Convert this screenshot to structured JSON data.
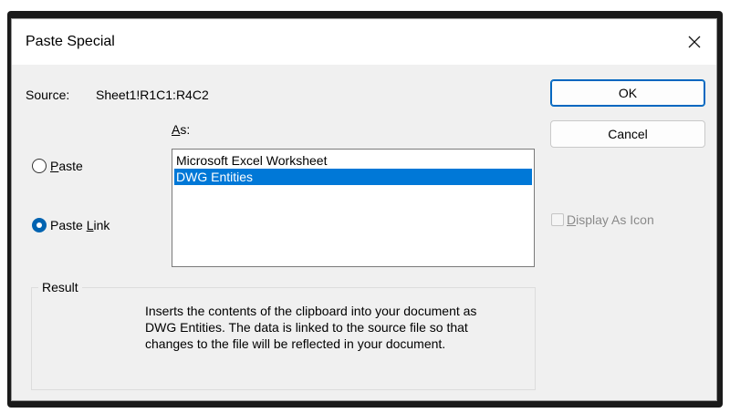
{
  "window": {
    "title": "Paste Special",
    "close_glyph": "×"
  },
  "source": {
    "label": "Source:",
    "value": "Sheet1!R1C1:R4C2"
  },
  "as_label": "As:",
  "radios": [
    {
      "label": "Paste",
      "checked": false
    },
    {
      "label": "Paste Link",
      "checked": true
    }
  ],
  "list": {
    "items": [
      {
        "label": "Microsoft Excel Worksheet",
        "selected": false
      },
      {
        "label": "DWG Entities",
        "selected": true
      }
    ]
  },
  "buttons": {
    "ok": "OK",
    "cancel": "Cancel"
  },
  "display_as_icon": {
    "label": "Display As Icon",
    "checked": false,
    "enabled": false
  },
  "result": {
    "title": "Result",
    "text": "Inserts the contents of the clipboard into your document as DWG Entities.  The data is linked to the source file so that changes to the file will be reflected in your document."
  },
  "colors": {
    "accent": "#0078d7",
    "dialog_bg": "#f0f0f0"
  }
}
